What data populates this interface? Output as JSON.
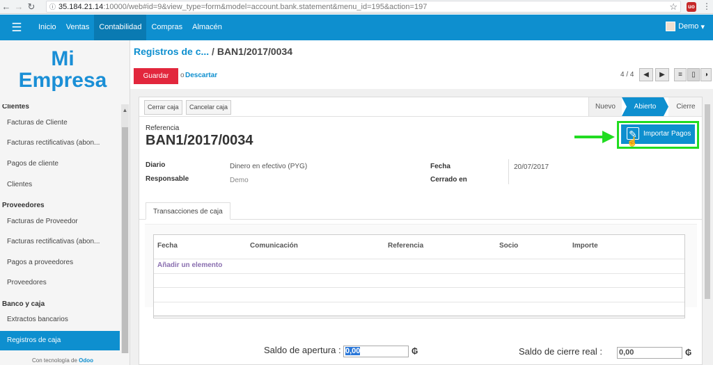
{
  "browser": {
    "url_host": "35.184.21.14",
    "url_rest": ":10000/web#id=9&view_type=form&model=account.bank.statement&menu_id=195&action=197"
  },
  "topnav": {
    "items": [
      "Inicio",
      "Ventas",
      "Contabilidad",
      "Compras",
      "Almacén"
    ],
    "active": "Contabilidad",
    "user": "Demo"
  },
  "sidebar": {
    "logo_line1": "Mi",
    "logo_line2": "Empresa",
    "clientes_head": "Clientes",
    "clientes_items": [
      "Facturas de Cliente",
      "Facturas rectificativas (abon...",
      "Pagos de cliente",
      "Clientes"
    ],
    "proveedores_head": "Proveedores",
    "proveedores_items": [
      "Facturas de Proveedor",
      "Facturas rectificativas (abon...",
      "Pagos a proveedores",
      "Proveedores"
    ],
    "banco_head": "Banco y caja",
    "banco_items": [
      "Extractos bancarios",
      "Registros de caja"
    ],
    "powered_text": "Con tecnología de",
    "powered_brand": "Odoo"
  },
  "breadcrumb": {
    "parent": "Registros de c...",
    "separator": "/",
    "current": "BAN1/2017/0034"
  },
  "actions": {
    "save": "Guardar",
    "or": "o",
    "discard": "Descartar"
  },
  "pager": {
    "text": "4 / 4"
  },
  "header": {
    "close_cash": "Cerrar caja",
    "cancel_cash": "Cancelar caja",
    "statuses": [
      "Nuevo",
      "Abierto",
      "Cierre"
    ],
    "active_status": "Abierto"
  },
  "form": {
    "ref_label": "Referencia",
    "ref_value": "BAN1/2017/0034",
    "import_button": "Importar Pagos",
    "diario_label": "Diario",
    "diario_value": "Dinero en efectivo (PYG)",
    "responsable_label": "Responsable",
    "responsable_value": "Demo",
    "fecha_label": "Fecha",
    "fecha_value": "20/07/2017",
    "cerrado_label": "Cerrado en",
    "tab": "Transacciones de caja"
  },
  "table": {
    "columns": [
      "Fecha",
      "Comunicación",
      "Referencia",
      "Socio",
      "Importe"
    ],
    "add_item": "Añadir un elemento"
  },
  "balances": {
    "opening_label": "Saldo de apertura :",
    "opening_value": "0,00",
    "closing_label": "Saldo de cierre real :",
    "closing_value": "0,00",
    "currency_symbol": "₲"
  },
  "colors": {
    "brand": "#0e8fcf",
    "save": "#e2273d",
    "highlight": "#21dc21"
  }
}
